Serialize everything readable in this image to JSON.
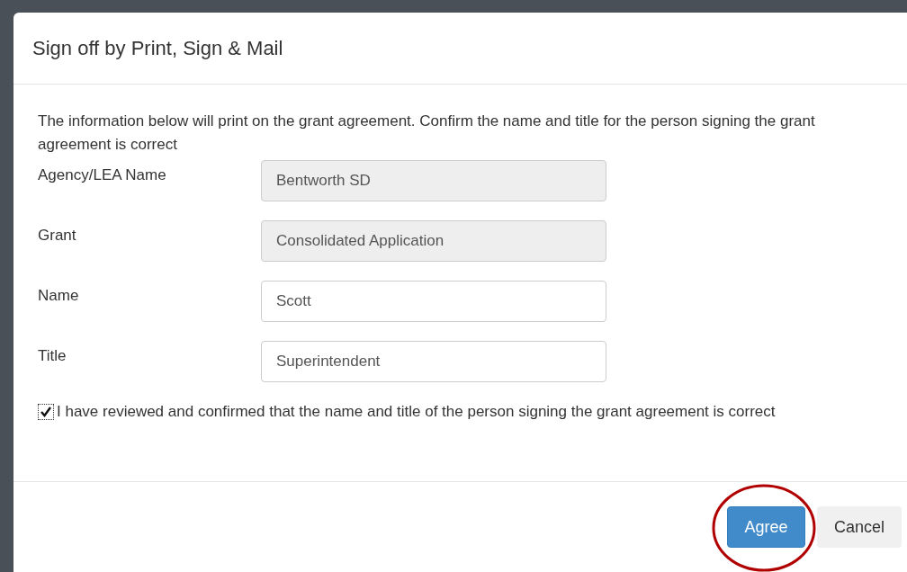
{
  "dialog": {
    "title": "Sign off by Print, Sign & Mail"
  },
  "intro": "The information below will print on the grant agreement. Confirm the name and title for the person signing the grant agreement is correct",
  "fields": [
    {
      "label": "Agency/LEA Name",
      "value": "Bentworth SD",
      "disabled": true
    },
    {
      "label": "Grant",
      "value": "Consolidated Application",
      "disabled": true
    },
    {
      "label": "Name",
      "value": "Scott",
      "disabled": false
    },
    {
      "label": "Title",
      "value": "Superintendent",
      "disabled": false
    }
  ],
  "confirmation": {
    "label": "I have reviewed and confirmed that the name and title of the person signing the grant agreement is correct",
    "checked": true
  },
  "buttons": [
    {
      "label": "Agree",
      "kind": "primary",
      "highlighted": true
    },
    {
      "label": "Cancel",
      "kind": "default",
      "highlighted": false
    }
  ]
}
